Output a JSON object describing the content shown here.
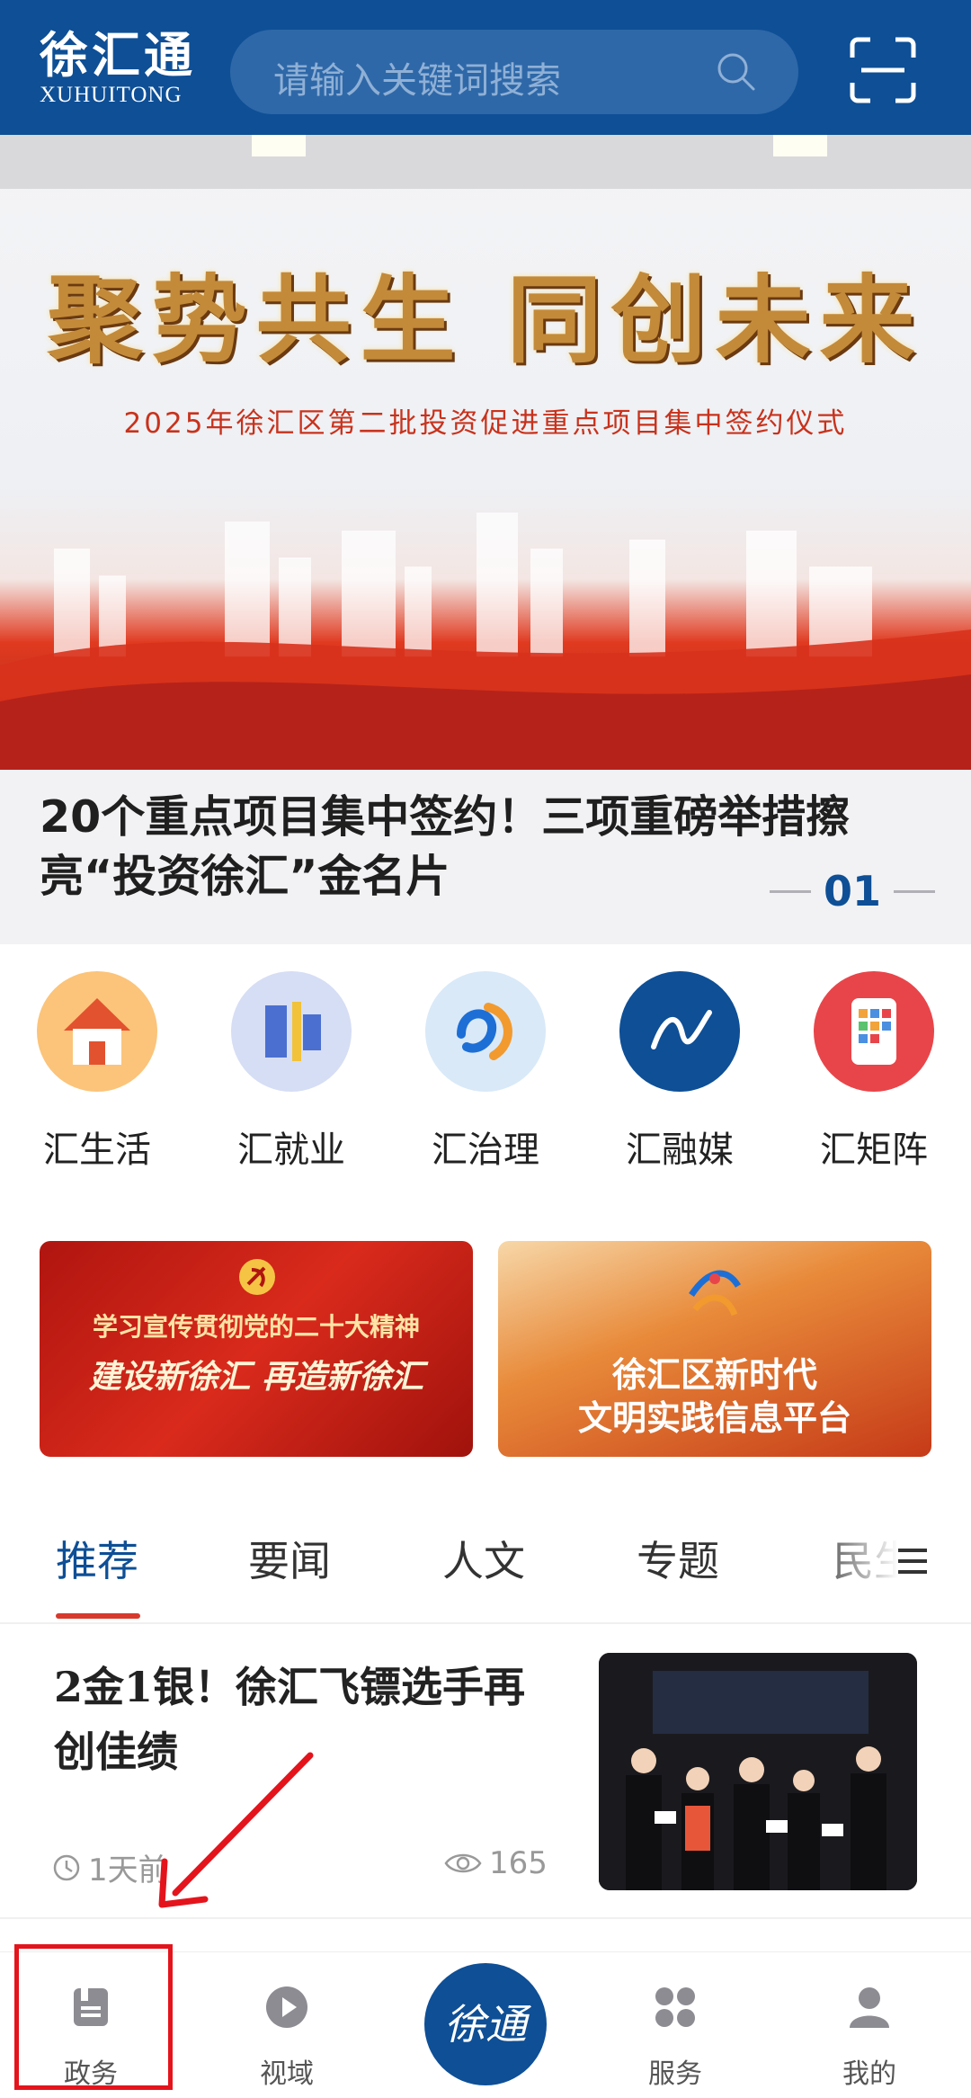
{
  "header": {
    "logo_cn": "徐汇通",
    "logo_en": "XUHUITONG",
    "search_placeholder": "请输入关键词搜索",
    "colors": {
      "primary": "#0e4f96"
    }
  },
  "banner": {
    "slogan": "聚势共生 同创未来",
    "subtitle": "2025年徐汇区第二批投资促进重点项目集中签约仪式"
  },
  "headline": {
    "title": "20个重点项目集中签约！三项重磅举措擦亮“投资徐汇”金名片",
    "page": "01"
  },
  "shortcuts": [
    {
      "label": "汇生活",
      "icon": "house-icon"
    },
    {
      "label": "汇就业",
      "icon": "recruit-icon"
    },
    {
      "label": "汇治理",
      "icon": "governance-icon"
    },
    {
      "label": "汇融媒",
      "icon": "media-icon"
    },
    {
      "label": "汇矩阵",
      "icon": "phone-apps-icon"
    }
  ],
  "promos": [
    {
      "line1": "学习宣传贯彻党的二十大精神",
      "line2": "建设新徐汇 再造新徐汇"
    },
    {
      "line1": "徐汇区新时代",
      "line2": "文明实践信息平台"
    }
  ],
  "tabs": [
    "推荐",
    "要闻",
    "人文",
    "专题",
    "民生"
  ],
  "article": {
    "title": "2金1银！徐汇飞镖选手再创佳绩",
    "time": "1天前",
    "views": "165"
  },
  "bottom_nav": [
    {
      "label": "政务",
      "icon": "document-icon"
    },
    {
      "label": "视域",
      "icon": "play-icon"
    },
    {
      "label": "服务",
      "icon": "grid-icon"
    },
    {
      "label": "我的",
      "icon": "user-icon"
    }
  ]
}
